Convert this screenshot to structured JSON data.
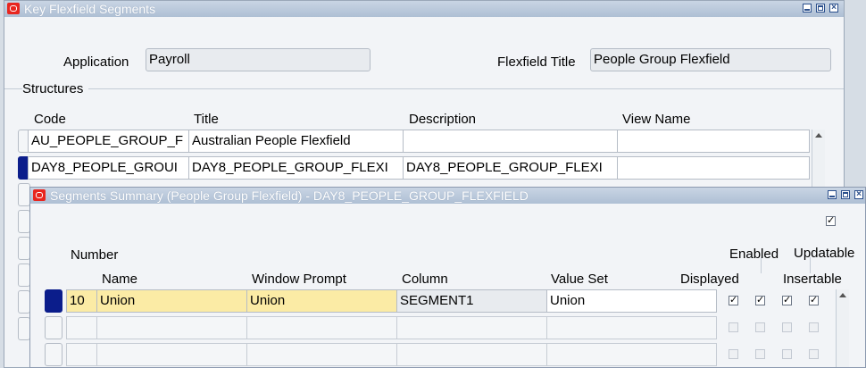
{
  "back_window": {
    "title": "Key Flexfield Segments",
    "application_label": "Application",
    "application_value": "Payroll",
    "flexfield_title_label": "Flexfield Title",
    "flexfield_title_value": "People Group Flexfield",
    "structures_label": "Structures",
    "columns": {
      "code": "Code",
      "title": "Title",
      "description": "Description",
      "view_name": "View Name"
    },
    "rows": [
      {
        "code": "AU_PEOPLE_GROUP_F",
        "title": "Australian People Flexfield",
        "description": "",
        "view_name": ""
      },
      {
        "code": "DAY8_PEOPLE_GROUI",
        "title": "DAY8_PEOPLE_GROUP_FLEXI",
        "description": "DAY8_PEOPLE_GROUP_FLEXI",
        "view_name": ""
      }
    ]
  },
  "front_window": {
    "title": "Segments Summary (People Group Flexfield) - DAY8_PEOPLE_GROUP_FLEXFIELD",
    "columns": {
      "number": "Number",
      "name": "Name",
      "window_prompt": "Window Prompt",
      "column": "Column",
      "value_set": "Value Set",
      "displayed": "Displayed",
      "enabled": "Enabled",
      "updatable": "Updatable",
      "insertable": "Insertable"
    },
    "rows": [
      {
        "number": "10",
        "name": "Union",
        "window_prompt": "Union",
        "column": "SEGMENT1",
        "value_set": "Union",
        "displayed": true,
        "enabled": true,
        "insertable": true,
        "updatable": true
      }
    ],
    "header_checkbox_checked": true
  },
  "icons": {
    "logo": "oracle-logo-icon",
    "minimize": "minimize-icon",
    "maximize": "maximize-icon",
    "close": "close-icon"
  }
}
